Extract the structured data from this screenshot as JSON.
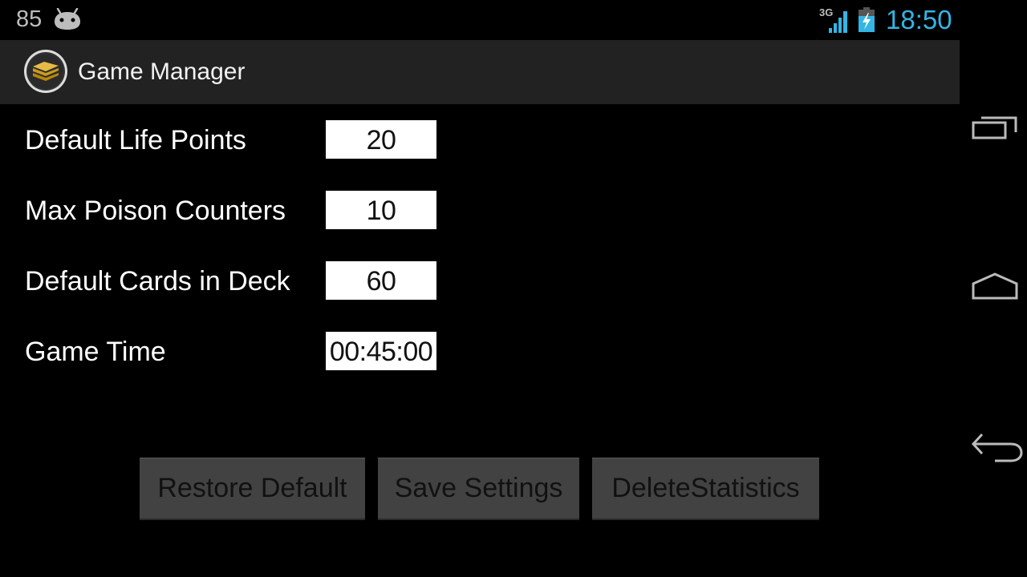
{
  "status_bar": {
    "left_text": "85",
    "notification_icon": "android-icon",
    "network_type": "3G",
    "signal_icon": "signal-icon",
    "battery_icon": "battery-charging-icon",
    "clock": "18:50",
    "accent_color": "#33b5e5"
  },
  "action_bar": {
    "app_icon": "card-stack-icon",
    "title": "Game Manager"
  },
  "settings": [
    {
      "label": "Default Life Points",
      "value": "20"
    },
    {
      "label": "Max Poison Counters",
      "value": "10"
    },
    {
      "label": "Default Cards in Deck",
      "value": "60"
    },
    {
      "label": "Game Time",
      "value": "00:45:00"
    }
  ],
  "buttons": {
    "restore": "Restore Default",
    "save": "Save Settings",
    "delete": "DeleteStatistics"
  },
  "nav_bar": {
    "recent": "recent-apps-icon",
    "home": "home-icon",
    "back": "back-icon"
  }
}
